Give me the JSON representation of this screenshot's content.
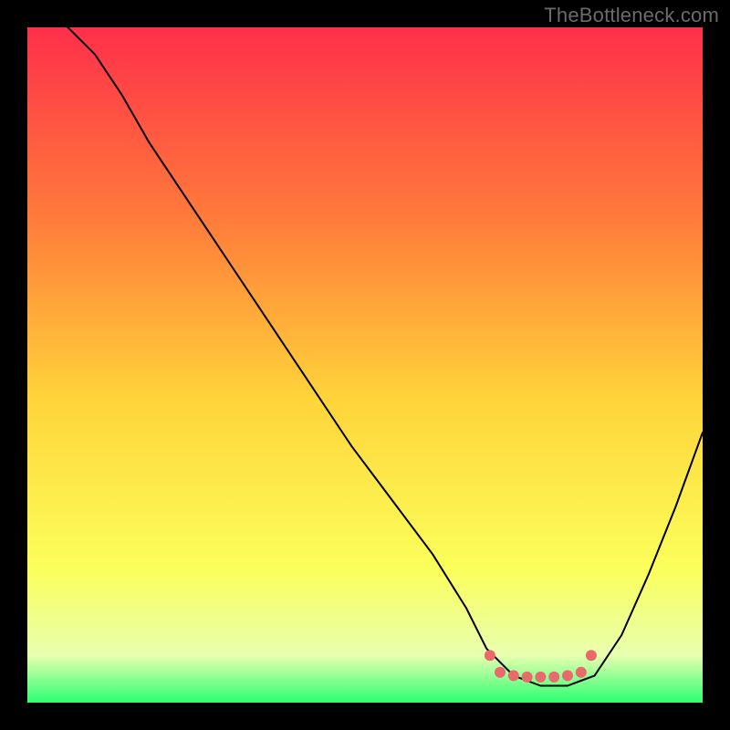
{
  "watermark": "TheBottleneck.com",
  "colors": {
    "frame_background": "#000000",
    "curve_stroke": "#000000",
    "marker_fill": "#e96a6a",
    "gradient_stops": [
      {
        "offset": "0%",
        "color": "#ff2f4a"
      },
      {
        "offset": "28%",
        "color": "#ff7a3a"
      },
      {
        "offset": "55%",
        "color": "#ffd43a"
      },
      {
        "offset": "80%",
        "color": "#fbff5a"
      },
      {
        "offset": "93%",
        "color": "#e8ffb0"
      },
      {
        "offset": "100%",
        "color": "#2bff72"
      }
    ]
  },
  "chart_data": {
    "type": "line",
    "title": "",
    "xlabel": "",
    "ylabel": "",
    "xlim": [
      0,
      100
    ],
    "ylim": [
      0,
      100
    ],
    "x": [
      6,
      10,
      14,
      18,
      24,
      30,
      36,
      42,
      48,
      54,
      60,
      65,
      68,
      72,
      76,
      80,
      84,
      88,
      92,
      96,
      100
    ],
    "values": [
      100,
      96,
      90,
      83,
      74,
      65,
      56,
      47,
      38,
      30,
      22,
      14,
      8,
      4,
      2.5,
      2.5,
      4,
      10,
      19,
      29,
      40
    ],
    "flat_segment": {
      "x_start": 68,
      "x_end": 84,
      "y": 3
    },
    "markers": [
      {
        "x": 68.5,
        "y": 7
      },
      {
        "x": 70,
        "y": 4.5
      },
      {
        "x": 72,
        "y": 4
      },
      {
        "x": 74,
        "y": 3.8
      },
      {
        "x": 76,
        "y": 3.8
      },
      {
        "x": 78,
        "y": 3.8
      },
      {
        "x": 80,
        "y": 4
      },
      {
        "x": 82,
        "y": 4.5
      },
      {
        "x": 83.5,
        "y": 7
      }
    ]
  }
}
